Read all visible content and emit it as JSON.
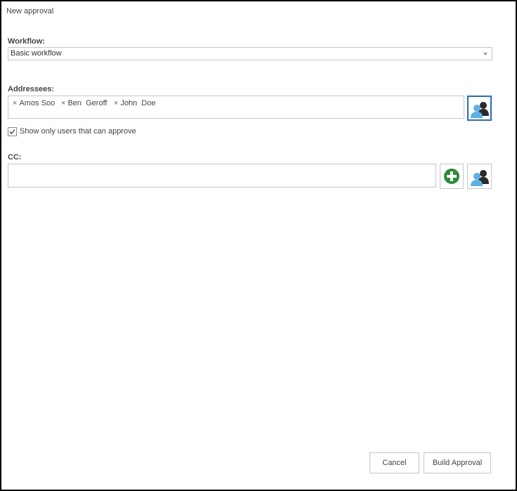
{
  "dialog": {
    "title": "New approval"
  },
  "workflow": {
    "label": "Workflow:",
    "selected": "Basic workflow"
  },
  "addressees": {
    "label": "Addressees:",
    "tags": [
      "Amos Soo",
      "Ben  Geroff",
      "John  Doe"
    ],
    "remove_glyph": "×"
  },
  "approve_filter": {
    "label": "Show only users that can approve",
    "checked": true
  },
  "cc": {
    "label": "CC:",
    "value": ""
  },
  "footer": {
    "cancel_label": "Cancel",
    "build_label": "Build Approval"
  },
  "icons": {
    "people_picker": "people-picker-icon",
    "add": "add-circle-icon",
    "remove": "remove-x-icon",
    "checkmark": "checkmark-icon",
    "dropdown": "chevron-down-icon"
  },
  "colors": {
    "person_front": "#5fb0e4",
    "person_back": "#2b2b2b",
    "add_green": "#2e8b3a",
    "active_border": "#2a6cb5"
  }
}
